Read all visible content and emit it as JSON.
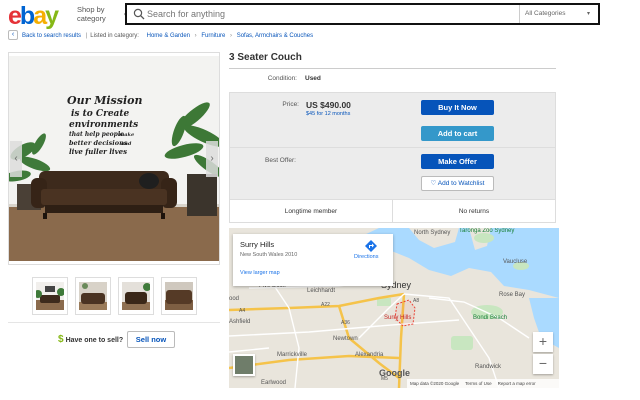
{
  "header": {
    "logo": [
      "e",
      "b",
      "a",
      "y"
    ],
    "shop_by": "Shop by category",
    "search_placeholder": "Search for anything",
    "category_select": "All Categories"
  },
  "breadcrumb": {
    "back": "Back to search results",
    "listed_in": "Listed in category:",
    "path": [
      "Home & Garden",
      "Furniture",
      "Sofas, Armchairs & Couches"
    ]
  },
  "gallery": {
    "main_image_text": [
      "Our Mission",
      "is to Create",
      "environments",
      "that help people",
      "make",
      "better decisions",
      "and",
      "live fuller lives"
    ],
    "thumbnail_count": 4,
    "have_one": "Have one to sell?",
    "sell_now": "Sell now"
  },
  "item": {
    "title": "3 Seater Couch",
    "condition_label": "Condition:",
    "condition_value": "Used",
    "price_label": "Price:",
    "price_value": "US $490.00",
    "monthly": "$45 for 12 months",
    "buy_now": "Buy It Now",
    "add_to_cart": "Add to cart",
    "best_offer_label": "Best Offer:",
    "make_offer": "Make Offer",
    "add_to_watchlist": "Add to Watchlist",
    "longtime_member": "Longtime member",
    "no_returns": "No returns"
  },
  "map": {
    "place_name": "Surry Hills",
    "place_address": "New South Wales 2010",
    "view_larger": "View larger map",
    "directions": "Directions",
    "labels": {
      "north_sydney": "North Sydney",
      "taronga": "Taronga Zoo Sydney",
      "vaucluse": "Vaucluse",
      "sydney": "Sydney",
      "rose_bay": "Rose Bay",
      "five_dock": "Five Dock",
      "leichhardt": "Leichhardt",
      "surry_hills": "Surry Hills",
      "bondi_beach": "Bondi Beach",
      "ashfield": "Ashfield",
      "newtown": "Newtown",
      "marrickville": "Marrickville",
      "alexandria": "Alexandria",
      "randwick": "Randwick",
      "earlwood": "Earlwood",
      "a22": "A22",
      "a36": "A36",
      "a4": "A4",
      "a8": "A8",
      "road_ood": "ood",
      "road_m5": "M5"
    },
    "google": "Google",
    "footer": [
      "Map data ©2020 Google",
      "Terms of Use",
      "Report a map error"
    ]
  },
  "colors": {
    "ebay_red": "#e53238",
    "ebay_blue": "#0064d2",
    "ebay_yellow": "#f5af02",
    "ebay_green": "#86b817",
    "button_primary": "#0654ba",
    "button_cart": "#3498ca",
    "water": "#aadaff",
    "parks": "#c8e6c0"
  }
}
